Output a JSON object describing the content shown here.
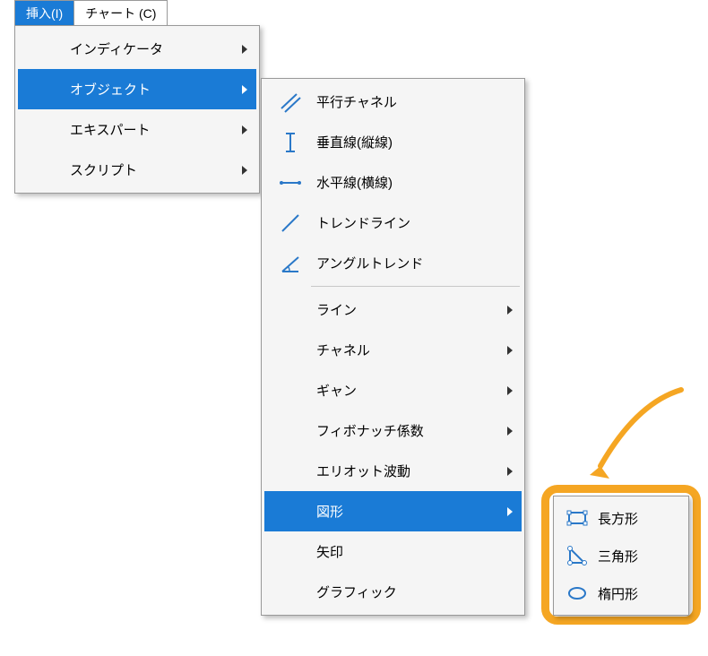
{
  "menubar": {
    "insert": "挿入(I)",
    "chart": "チャート (C)"
  },
  "panel1": {
    "items": [
      {
        "label": "インディケータ",
        "submenu": true,
        "selected": false
      },
      {
        "label": "オブジェクト",
        "submenu": true,
        "selected": true
      },
      {
        "label": "エキスパート",
        "submenu": true,
        "selected": false
      },
      {
        "label": "スクリプト",
        "submenu": true,
        "selected": false
      }
    ]
  },
  "panel2": {
    "groupA": [
      {
        "label": "平行チャネル",
        "icon": "parallel-channel-icon"
      },
      {
        "label": "垂直線(縦線)",
        "icon": "vertical-line-icon"
      },
      {
        "label": "水平線(横線)",
        "icon": "horizontal-line-icon"
      },
      {
        "label": "トレンドライン",
        "icon": "trend-line-icon"
      },
      {
        "label": "アングルトレンド",
        "icon": "angle-trend-icon"
      }
    ],
    "groupB": [
      {
        "label": "ライン",
        "submenu": true
      },
      {
        "label": "チャネル",
        "submenu": true
      },
      {
        "label": "ギャン",
        "submenu": true
      },
      {
        "label": "フィボナッチ係数",
        "submenu": true
      },
      {
        "label": "エリオット波動",
        "submenu": true
      },
      {
        "label": "図形",
        "submenu": true,
        "selected": true
      },
      {
        "label": "矢印",
        "submenu": false
      },
      {
        "label": "グラフィック",
        "submenu": false
      }
    ]
  },
  "panel3": {
    "items": [
      {
        "label": "長方形",
        "icon": "rectangle-shape-icon"
      },
      {
        "label": "三角形",
        "icon": "triangle-shape-icon"
      },
      {
        "label": "楕円形",
        "icon": "ellipse-shape-icon"
      }
    ]
  }
}
